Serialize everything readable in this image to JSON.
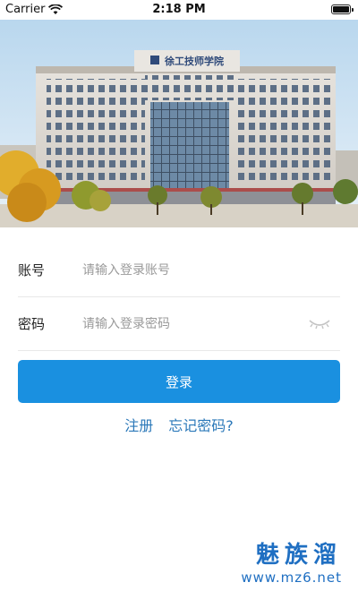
{
  "status": {
    "carrier": "Carrier",
    "time": "2:18 PM"
  },
  "hero": {
    "building_sign": "徐工技师学院"
  },
  "form": {
    "account_label": "账号",
    "account_placeholder": "请输入登录账号",
    "password_label": "密码",
    "password_placeholder": "请输入登录密码"
  },
  "actions": {
    "login": "登录",
    "register": "注册",
    "forgot": "忘记密码?"
  },
  "watermark": {
    "title": "魅族溜",
    "url": "www.mz6.net"
  },
  "colors": {
    "primary": "#1a90e0",
    "link": "#2b78b9",
    "watermark": "#1f6fc2"
  }
}
